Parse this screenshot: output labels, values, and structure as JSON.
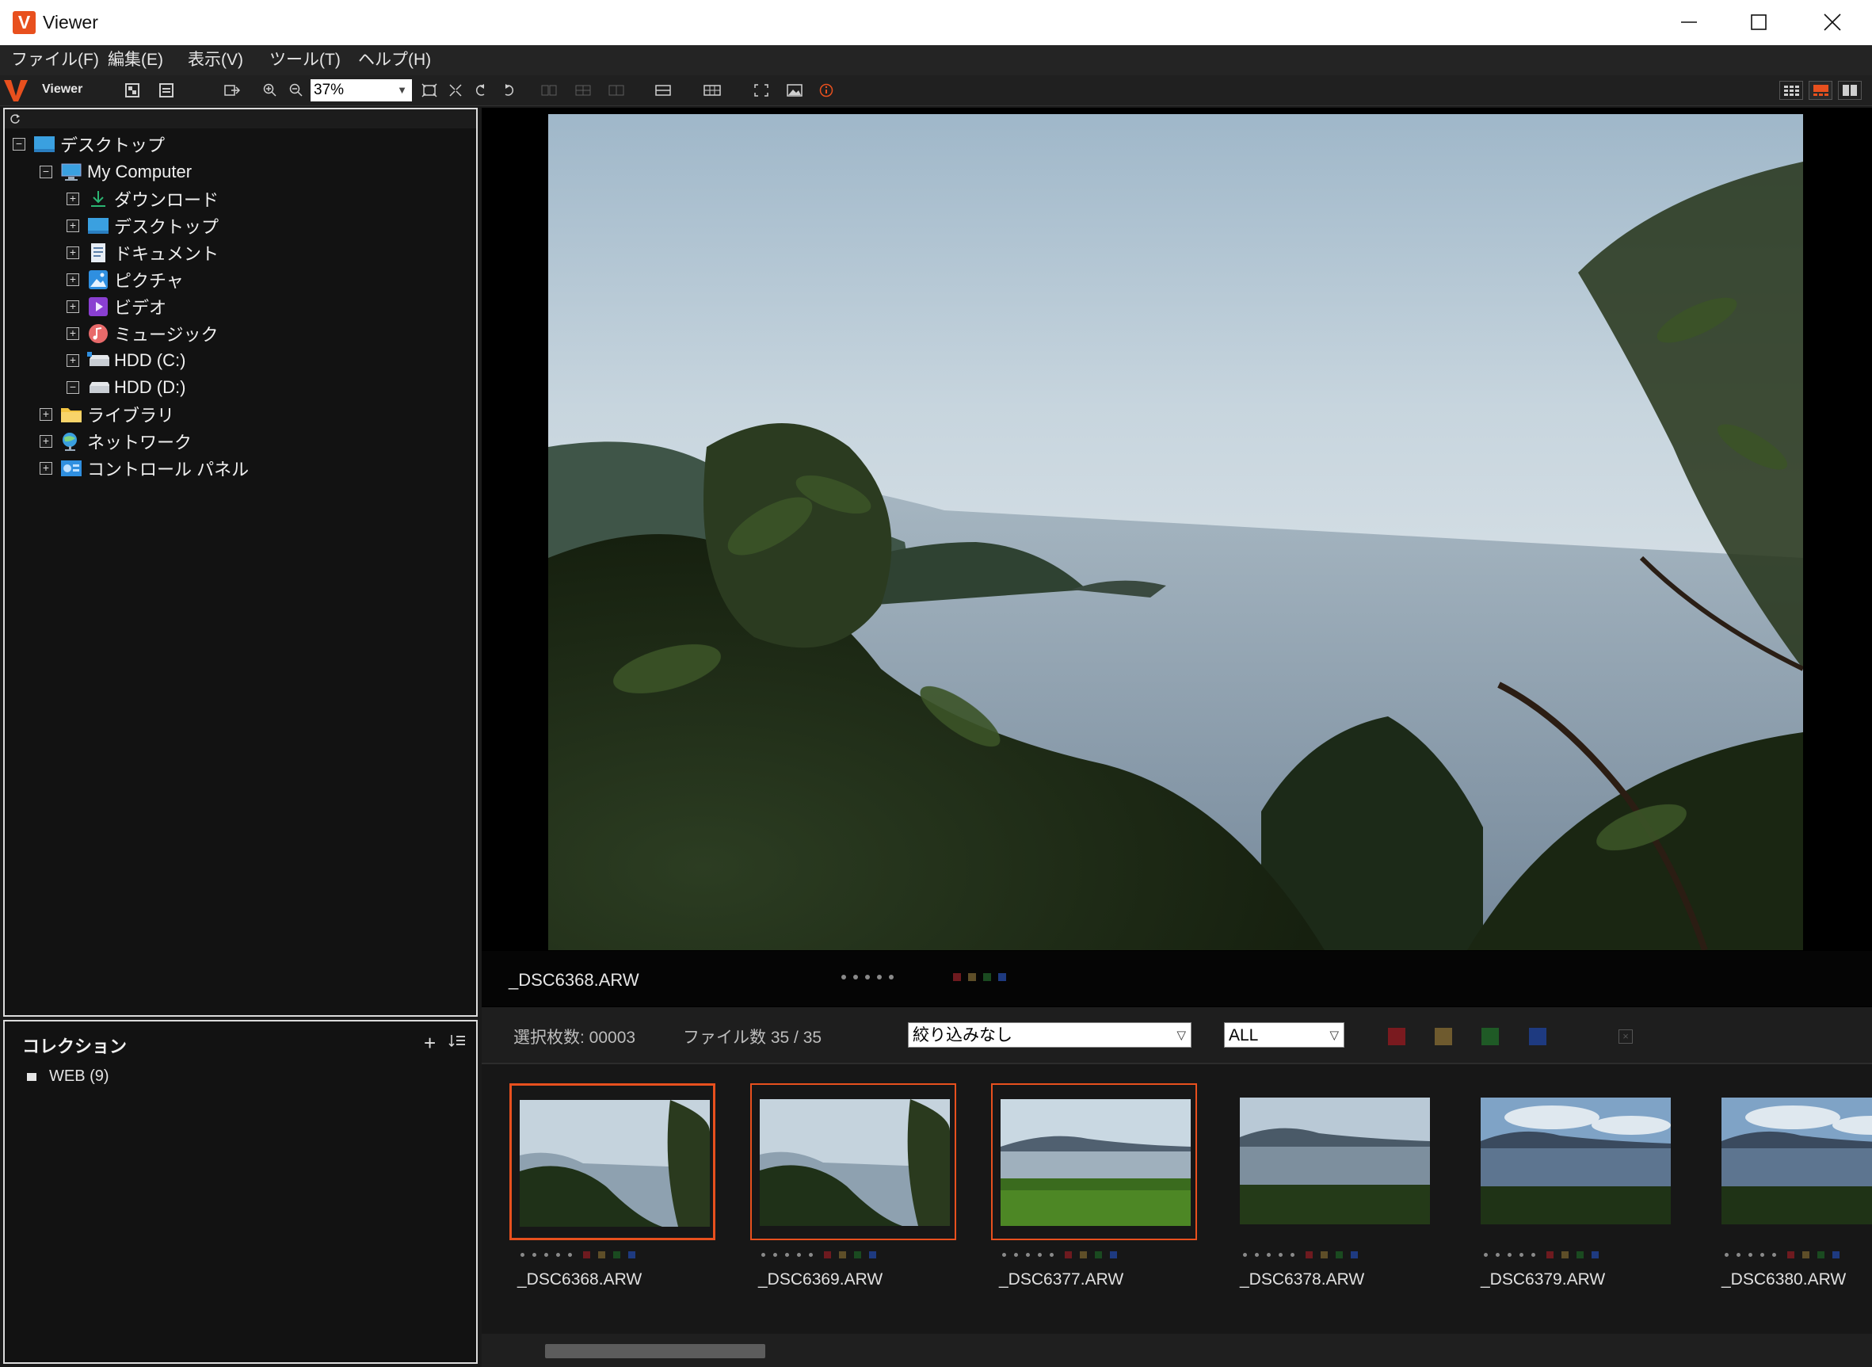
{
  "window": {
    "title": "Viewer",
    "logo_letter": "V"
  },
  "menu": {
    "items": [
      "ファイル(F)",
      "編集(E)",
      "表示(V)",
      "ツール(T)",
      "ヘルプ(H)"
    ]
  },
  "toolbar": {
    "mode_label": "Viewer",
    "zoom_value": "37%"
  },
  "tree": {
    "items": [
      {
        "label": "デスクトップ",
        "icon": "desktop-icon",
        "expander": "−"
      },
      {
        "label": "My Computer",
        "icon": "computer-icon",
        "expander": "−"
      },
      {
        "label": "ダウンロード",
        "icon": "download-icon",
        "expander": "+"
      },
      {
        "label": "デスクトップ",
        "icon": "desktop-icon",
        "expander": "+"
      },
      {
        "label": "ドキュメント",
        "icon": "document-icon",
        "expander": "+"
      },
      {
        "label": "ピクチャ",
        "icon": "pictures-icon",
        "expander": "+"
      },
      {
        "label": "ビデオ",
        "icon": "video-icon",
        "expander": "+"
      },
      {
        "label": "ミュージック",
        "icon": "music-icon",
        "expander": "+"
      },
      {
        "label": "HDD (C:)",
        "icon": "drive-icon",
        "expander": "+"
      },
      {
        "label": "HDD (D:)",
        "icon": "drive-icon",
        "expander": "−"
      },
      {
        "label": "ライブラリ",
        "icon": "folder-icon",
        "expander": "+"
      },
      {
        "label": "ネットワーク",
        "icon": "network-icon",
        "expander": "+"
      },
      {
        "label": "コントロール パネル",
        "icon": "control-panel-icon",
        "expander": "+"
      }
    ]
  },
  "collection": {
    "title": "コレクション",
    "add_label": "+",
    "items": [
      {
        "label": "WEB (9)"
      }
    ]
  },
  "preview": {
    "filename": "_DSC6368.ARW"
  },
  "filter": {
    "selected_count": "選択枚数: 00003",
    "file_count": "ファイル数 35 / 35",
    "filter_select": "絞り込みなし",
    "rating_select": "ALL"
  },
  "colors": {
    "accent": "#e8501e",
    "label_red": "#7a1a1f",
    "label_yellow": "#6e5a2e",
    "label_green": "#1f5a26",
    "label_blue": "#1e3a80"
  },
  "thumbnails": [
    {
      "name": "_DSC6368.ARW",
      "selected": true,
      "scene": "cliff"
    },
    {
      "name": "_DSC6369.ARW",
      "selected": true,
      "scene": "cliff"
    },
    {
      "name": "_DSC6377.ARW",
      "selected": true,
      "scene": "lake-grass"
    },
    {
      "name": "_DSC6378.ARW",
      "selected": false,
      "scene": "lake-dark"
    },
    {
      "name": "_DSC6379.ARW",
      "selected": false,
      "scene": "lake-blue"
    },
    {
      "name": "_DSC6380.ARW",
      "selected": false,
      "scene": "lake-blue"
    }
  ]
}
